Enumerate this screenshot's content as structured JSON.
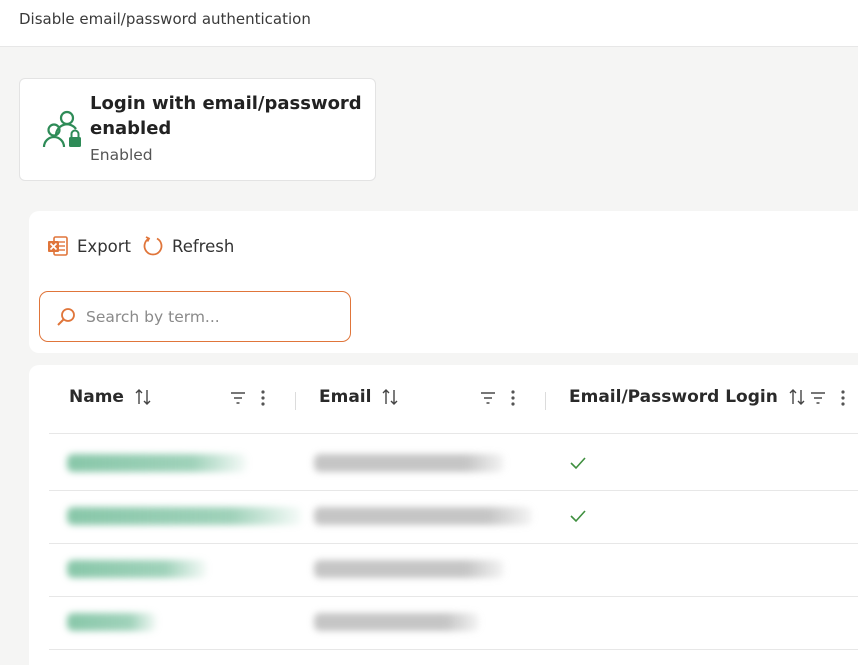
{
  "header": {
    "title": "Disable email/password authentication"
  },
  "card": {
    "heading": "Login with email/password enabled",
    "status": "Enabled",
    "icon": "users-lock-icon"
  },
  "toolbar": {
    "export_label": "Export",
    "refresh_label": "Refresh"
  },
  "search": {
    "placeholder": "Search by term..."
  },
  "table": {
    "columns": [
      {
        "label": "Name"
      },
      {
        "label": "Email"
      },
      {
        "label": "Email/Password Login"
      }
    ],
    "rows": [
      {
        "name": "",
        "email": "",
        "email_password_login": true
      },
      {
        "name": "",
        "email": "",
        "email_password_login": true
      },
      {
        "name": "",
        "email": "",
        "email_password_login": false
      },
      {
        "name": "",
        "email": "",
        "email_password_login": false
      }
    ]
  },
  "colors": {
    "accent": "#e0753a",
    "brand_green": "#2e8b57",
    "check_green": "#3f8f3f"
  }
}
